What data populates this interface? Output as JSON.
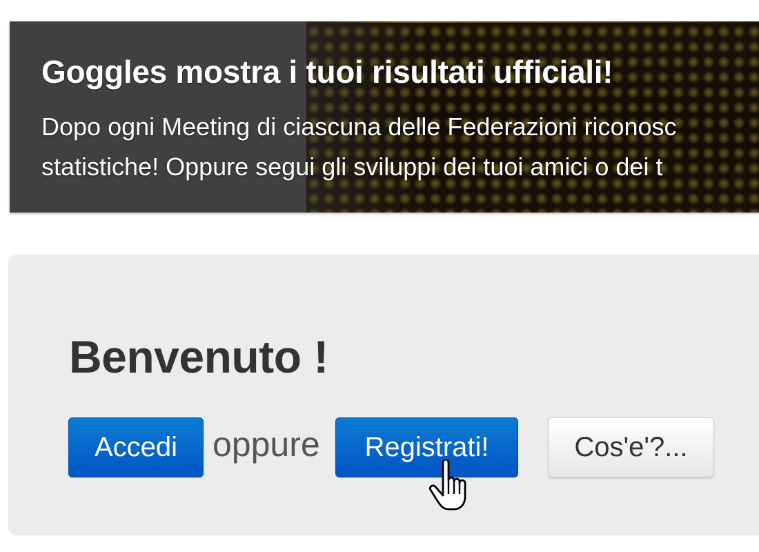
{
  "hero": {
    "title": "Goggles mostra i tuoi risultati ufficiali!",
    "line1": "Dopo ogni Meeting di ciascuna delle Federazioni riconosc",
    "line2": "statistiche! Oppure segui gli sviluppi dei tuoi amici o dei t"
  },
  "welcome": {
    "title": "Benvenuto !",
    "login_label": "Accedi",
    "separator": "oppure",
    "register_label": "Registrati!",
    "about_label": "Cos'e'?..."
  },
  "colors": {
    "primary_button": "#0355c4",
    "hero_background": "#404040",
    "welcome_background": "#ececec"
  },
  "icons": {
    "pointer": "hand-pointer-cursor-icon"
  }
}
